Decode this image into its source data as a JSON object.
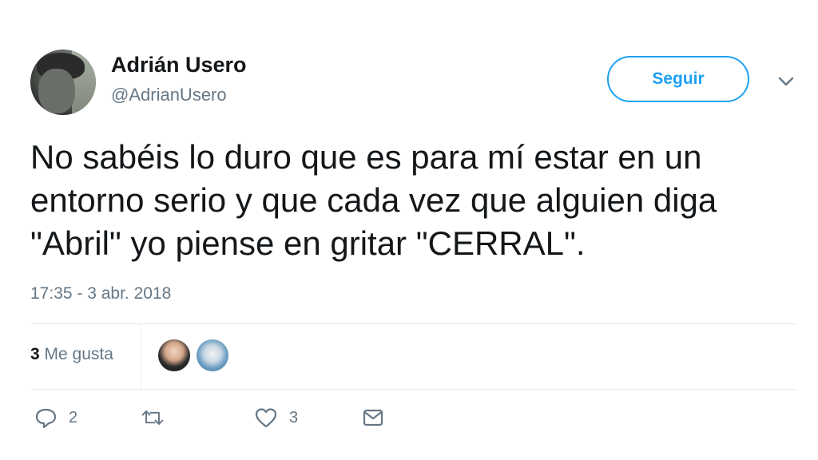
{
  "author": {
    "name": "Adrián Usero",
    "handle": "@AdrianUsero",
    "avatar_icon": "user-avatar-photo"
  },
  "follow_button": {
    "label": "Seguir",
    "color": "#1da1f2"
  },
  "menu": {
    "icon": "chevron-down-icon"
  },
  "tweet": {
    "text": "No sabéis lo duro que es para mí estar en un entorno serio y que cada vez que alguien diga \"Abril\" yo piense en gritar \"CERRAL\".",
    "timestamp": "17:35 - 3 abr. 2018"
  },
  "stats": {
    "likes_count": "3",
    "likes_label": "Me gusta",
    "likers": [
      "liker-avatar-1",
      "liker-avatar-2"
    ]
  },
  "actions": {
    "reply": {
      "icon": "reply-icon",
      "count": "2"
    },
    "retweet": {
      "icon": "retweet-icon",
      "count": ""
    },
    "like": {
      "icon": "heart-icon",
      "count": "3"
    },
    "message": {
      "icon": "envelope-icon",
      "count": ""
    }
  },
  "colors": {
    "accent": "#1da1f2",
    "muted": "#657786",
    "text": "#14171a",
    "divider": "#e6ecf0"
  }
}
